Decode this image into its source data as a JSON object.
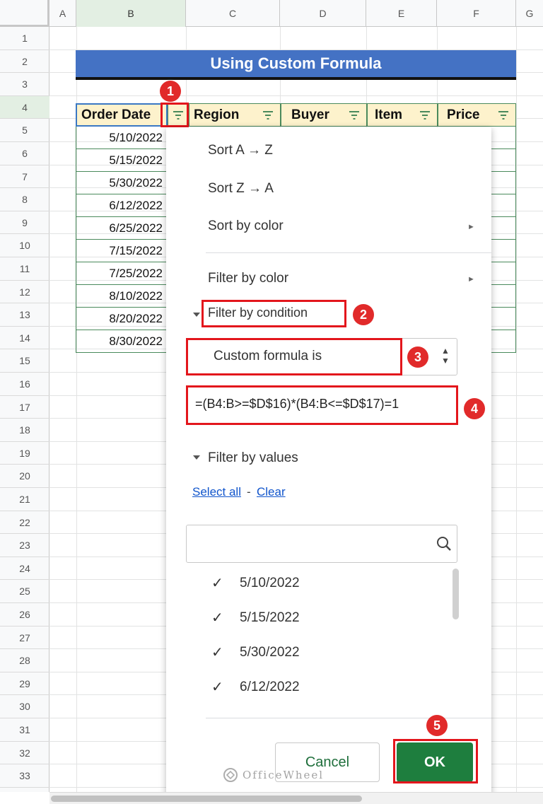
{
  "columns": [
    "A",
    "B",
    "C",
    "D",
    "E",
    "F",
    "G"
  ],
  "rows": [
    "1",
    "2",
    "3",
    "4",
    "5",
    "6",
    "7",
    "8",
    "9",
    "10",
    "11",
    "12",
    "13",
    "14",
    "15",
    "16",
    "17",
    "18",
    "19",
    "20",
    "21",
    "22",
    "23",
    "24",
    "25",
    "26",
    "27",
    "28",
    "29",
    "30",
    "31",
    "32",
    "33"
  ],
  "title": "Using Custom Formula",
  "table": {
    "headers": [
      "Order Date",
      "Region",
      "Buyer",
      "Item",
      "Price"
    ],
    "order_dates": [
      "5/10/2022",
      "5/15/2022",
      "5/30/2022",
      "6/12/2022",
      "6/25/2022",
      "7/15/2022",
      "7/25/2022",
      "8/10/2022",
      "8/20/2022",
      "8/30/2022"
    ]
  },
  "menu": {
    "sort_az": "Sort A → Z",
    "sort_za": "Sort Z → A",
    "sort_color": "Sort by color",
    "filter_color": "Filter by color",
    "filter_condition": "Filter by condition",
    "condition_value": "Custom formula is",
    "formula": "=(B4:B>=$D$16)*(B4:B<=$D$17)=1",
    "filter_values": "Filter by values",
    "select_all": "Select all",
    "separator": "-",
    "clear": "Clear",
    "search_placeholder": "",
    "values": [
      "5/10/2022",
      "5/15/2022",
      "5/30/2022",
      "6/12/2022"
    ],
    "cancel": "Cancel",
    "ok": "OK",
    "arrow": "►",
    "check": "✓"
  },
  "markers": [
    "1",
    "2",
    "3",
    "4",
    "5"
  ],
  "watermark": "OfficeWheel",
  "colors": {
    "title_bg": "#4472c4",
    "header_bg": "#fdf2cc",
    "ok_bg": "#1e7e3e",
    "annotation_red": "#e3161c"
  }
}
